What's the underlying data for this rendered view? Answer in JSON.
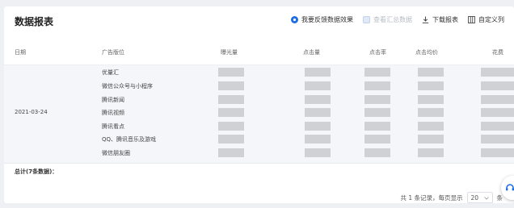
{
  "header": {
    "title": "数据报表",
    "feedback_label": "我要反馈数据效果",
    "summary_label": "查看汇总数据",
    "download_label": "下载报表",
    "custom_columns_label": "自定义列"
  },
  "table": {
    "columns": [
      "日期",
      "广告版位",
      "曝光量",
      "点击量",
      "点击率",
      "点击均价",
      "花费"
    ],
    "date": "2021-03-24",
    "placements": [
      "优量汇",
      "微信公众号与小程序",
      "腾讯新闻",
      "腾讯视频",
      "腾讯看点",
      "QQ、腾讯音乐及游戏",
      "微信朋友圈"
    ],
    "total_label": "总计(7条数据)："
  },
  "pagination": {
    "summary": "共 1 条记录，每页显示",
    "page_size": "20",
    "unit": "条"
  },
  "colors": {
    "accent": "#1d6ee6",
    "placeholder": "#cfd1d4",
    "row_background": "#f5f6f9"
  },
  "icons": [
    "feedback-icon",
    "checkbox-icon",
    "download-icon",
    "columns-icon",
    "chevron-down-icon",
    "support-icon"
  ]
}
